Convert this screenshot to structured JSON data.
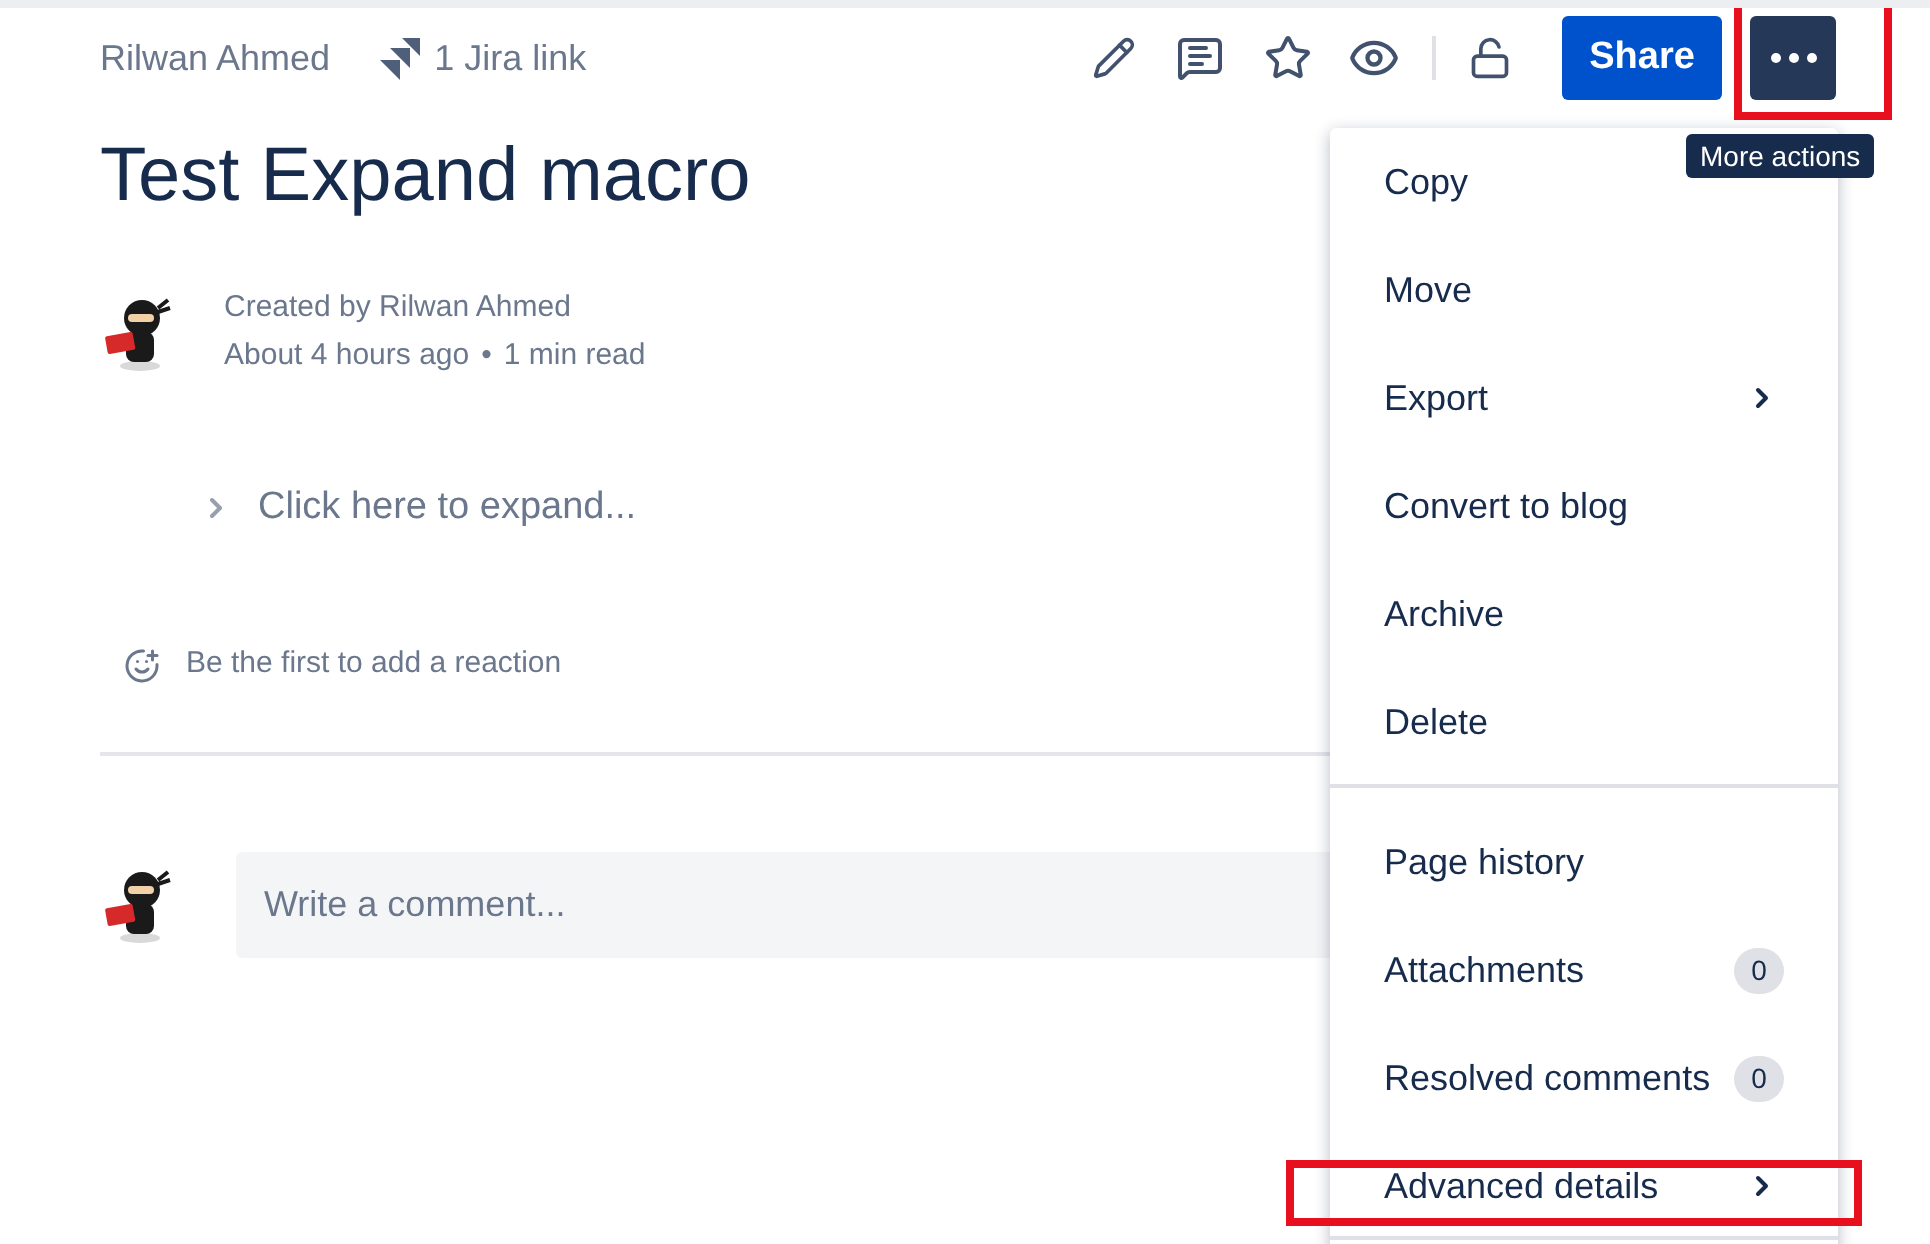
{
  "header": {
    "author": "Rilwan Ahmed",
    "jira_link": "1 Jira link",
    "share_button": "Share",
    "more_highlighted": true,
    "more_tooltip": "More actions"
  },
  "page": {
    "title": "Test Expand macro",
    "byline": "Created by Rilwan Ahmed",
    "age": "About 4 hours ago",
    "separator": "•",
    "read_time": "1 min read"
  },
  "expand": {
    "label": "Click here to expand...",
    "expanded": false
  },
  "reaction": "Be the first to add a reaction",
  "comment": {
    "placeholder": "Write a comment..."
  },
  "menu": {
    "sections": [
      [
        {
          "label": "Copy",
          "kind": "plain",
          "highlighted": false
        },
        {
          "label": "Move",
          "kind": "plain",
          "highlighted": false
        },
        {
          "label": "Export",
          "kind": "submenu",
          "highlighted": false
        },
        {
          "label": "Convert to blog",
          "kind": "plain",
          "highlighted": false
        },
        {
          "label": "Archive",
          "kind": "plain",
          "highlighted": false
        },
        {
          "label": "Delete",
          "kind": "plain",
          "highlighted": false
        }
      ],
      [
        {
          "label": "Page history",
          "kind": "plain",
          "highlighted": false
        },
        {
          "label": "Attachments",
          "kind": "count",
          "count": "0",
          "highlighted": false
        },
        {
          "label": "Resolved comments",
          "kind": "count",
          "count": "0",
          "highlighted": false
        },
        {
          "label": "Advanced details",
          "kind": "submenu",
          "highlighted": true
        }
      ]
    ]
  }
}
